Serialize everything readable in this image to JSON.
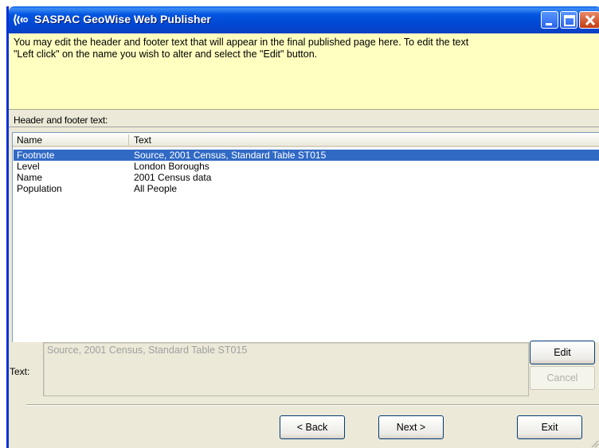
{
  "window": {
    "title": "SASPAC GeoWise Web Publisher"
  },
  "info": {
    "message": "You may edit the header and footer text that will appear in the final published page here.  To edit the text\n\"Left click\" on the name you wish to alter and select the \"Edit\" button."
  },
  "section": {
    "label": "Header and footer text:"
  },
  "list": {
    "columns": [
      "Name",
      "Text"
    ],
    "rows": [
      {
        "name": "Footnote",
        "text": "Source, 2001 Census, Standard Table ST015",
        "selected": true
      },
      {
        "name": "Level",
        "text": "London Boroughs",
        "selected": false
      },
      {
        "name": "Name",
        "text": "2001 Census data",
        "selected": false
      },
      {
        "name": "Population",
        "text": "All People",
        "selected": false
      }
    ]
  },
  "editor": {
    "label": "Text:",
    "value": "Source, 2001 Census, Standard Table ST015"
  },
  "buttons": {
    "edit": "Edit",
    "cancel": "Cancel",
    "back": "< Back",
    "next": "Next >",
    "exit": "Exit"
  },
  "colors": {
    "titlebar": "#0355e0",
    "info_background": "#ffffc0",
    "selection": "#316ac5",
    "window_background": "#ece9d8"
  }
}
